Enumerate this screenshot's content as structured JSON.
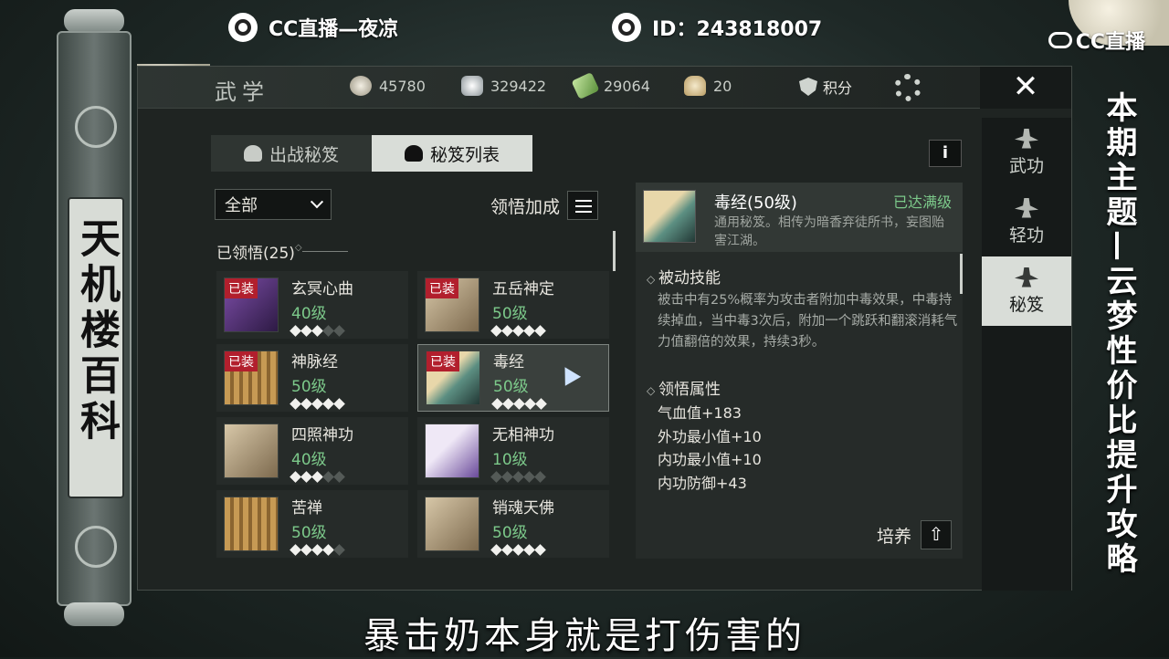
{
  "stream": {
    "channel": "CC直播—夜凉",
    "id_text": "ID：243818007",
    "brand": "CC直播"
  },
  "scroll_title": "天机楼百科",
  "right_title": "本期主题—云梦性价比提升攻略",
  "subtitle": "暴击奶本身就是打伤害的",
  "window": {
    "title": "武学",
    "currencies": [
      {
        "icon": "coin-icon",
        "value": "45780"
      },
      {
        "icon": "silver-icon",
        "value": "329422"
      },
      {
        "icon": "jade-icon",
        "value": "29064"
      },
      {
        "icon": "bun-icon",
        "value": "20"
      }
    ],
    "score_label": "积分",
    "close_label": "✕"
  },
  "side_nav": [
    {
      "label": "武功",
      "active": false
    },
    {
      "label": "轻功",
      "active": false
    },
    {
      "label": "秘笈",
      "active": true
    }
  ],
  "tabs": [
    {
      "label": "出战秘笈",
      "active": false
    },
    {
      "label": "秘笈列表",
      "active": true
    }
  ],
  "info_label": "i",
  "filter": {
    "selected": "全部"
  },
  "bonus_label": "领悟加成",
  "learned_label": "已领悟(25)",
  "cards": [
    {
      "name": "玄冥心曲",
      "level": "40级",
      "equipped": true,
      "stars": 3,
      "thumb": "purple"
    },
    {
      "name": "五岳神定",
      "level": "50级",
      "equipped": true,
      "stars": 5,
      "thumb": "book"
    },
    {
      "name": "神脉经",
      "level": "50级",
      "equipped": true,
      "stars": 5,
      "thumb": "bamboo"
    },
    {
      "name": "毒经",
      "level": "50级",
      "equipped": true,
      "stars": 5,
      "thumb": "scroll",
      "selected": true
    },
    {
      "name": "四照神功",
      "level": "40级",
      "equipped": false,
      "stars": 3,
      "thumb": "book"
    },
    {
      "name": "无相神功",
      "level": "10级",
      "equipped": false,
      "stars": 0,
      "thumb": "violetbook"
    },
    {
      "name": "苦禅",
      "level": "50级",
      "equipped": false,
      "stars": 4,
      "thumb": "bamboo"
    },
    {
      "name": "销魂天佛",
      "level": "50级",
      "equipped": false,
      "stars": 5,
      "thumb": "book"
    }
  ],
  "equipped_badge": "已装",
  "detail": {
    "name": "毒经(50级)",
    "max_label": "已达满级",
    "desc": "通用秘笈。相传为暗香弃徒所书，妄图贻害江湖。",
    "passive_title": "被动技能",
    "passive_text": "被击中有25%概率为攻击者附加中毒效果，中毒持续掉血，当中毒3次后，附加一个跳跃和翻滚消耗气力值翻倍的效果，持续3秒。",
    "attr_title": "领悟属性",
    "attrs": [
      "气血值+183",
      "外功最小值+10",
      "内功最小值+10",
      "内功防御+43"
    ],
    "train_label": "培养"
  }
}
